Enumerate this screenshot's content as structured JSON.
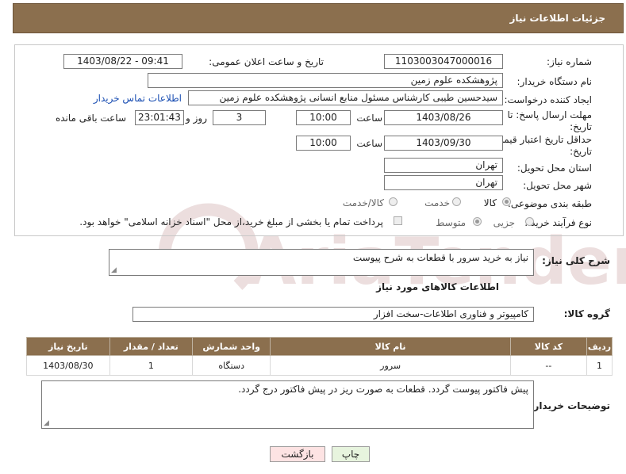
{
  "header": {
    "title": "جزئیات اطلاعات نیاز"
  },
  "need_number": {
    "label": "شماره نیاز:",
    "value": "1103003047000016"
  },
  "announce_datetime": {
    "label": "تاریخ و ساعت اعلان عمومی:",
    "value": "1403/08/22 - 09:41"
  },
  "buyer_org": {
    "label": "نام دستگاه خریدار:",
    "value": "پژوهشکده علوم زمین"
  },
  "requester": {
    "label": "ایجاد کننده درخواست:",
    "value": "سیدحسین طیبی کارشناس مسئول منابع انسانی پژوهشکده علوم زمین",
    "contact_link": "اطلاعات تماس خریدار"
  },
  "response_deadline": {
    "label_line1": "مهلت ارسال پاسخ: تا",
    "label_line2": "تاریخ:",
    "date": "1403/08/26",
    "time_label": "ساعت",
    "time": "10:00",
    "days": "3",
    "days_label": "روز و",
    "remaining": "23:01:43",
    "remaining_label": "ساعت باقی مانده"
  },
  "price_validity": {
    "label_line1": "حداقل تاریخ اعتبار قیمت: تا",
    "label_line2": "تاریخ:",
    "date": "1403/09/30",
    "time_label": "ساعت",
    "time": "10:00"
  },
  "delivery_province": {
    "label": "استان محل تحویل:",
    "value": "تهران"
  },
  "delivery_city": {
    "label": "شهر محل تحویل:",
    "value": "تهران"
  },
  "category": {
    "label": "طبقه بندی موضوعی:",
    "options": [
      "کالا",
      "خدمت",
      "کالا/خدمت"
    ],
    "selected": "کالا"
  },
  "purchase_process": {
    "label": "نوع فرآیند خرید :",
    "options": [
      "جزیی",
      "متوسط"
    ],
    "selected": "متوسط",
    "payment_note": "پرداخت تمام یا بخشی از مبلغ خرید،از محل \"اسناد خزانه اسلامی\" خواهد بود."
  },
  "need_description": {
    "label": "شرح کلی نیاز:",
    "value": "نیاز به خرید سرور با قطعات به شرح پیوست"
  },
  "goods_info": {
    "title": "اطلاعات کالاهای مورد نیاز"
  },
  "goods_group": {
    "label": "گروه کالا:",
    "value": "کامپیوتر و فناوری اطلاعات-سخت افزار"
  },
  "items_table": {
    "headers": [
      "ردیف",
      "کد کالا",
      "نام کالا",
      "واحد شمارش",
      "تعداد / مقدار",
      "تاریخ نیاز"
    ],
    "rows": [
      {
        "row": "1",
        "code": "--",
        "name": "سرور",
        "unit": "دستگاه",
        "qty": "1",
        "date": "1403/08/30"
      }
    ]
  },
  "buyer_notes": {
    "label": "توضیحات خریدار:",
    "value": "پیش فاکتور پیوست گردد. قطعات به صورت ریز در پیش فاکتور درج گردد."
  },
  "buttons": {
    "print": "چاپ",
    "back": "بازگشت"
  },
  "watermark": {
    "text": "AriaTender.neT"
  },
  "colors": {
    "header_bg": "#8b6f4e",
    "link": "#1b4fb3",
    "back_button_bg": "#fde3e3",
    "print_button_bg": "#e7f4de",
    "watermark": "#e9d9d9"
  }
}
